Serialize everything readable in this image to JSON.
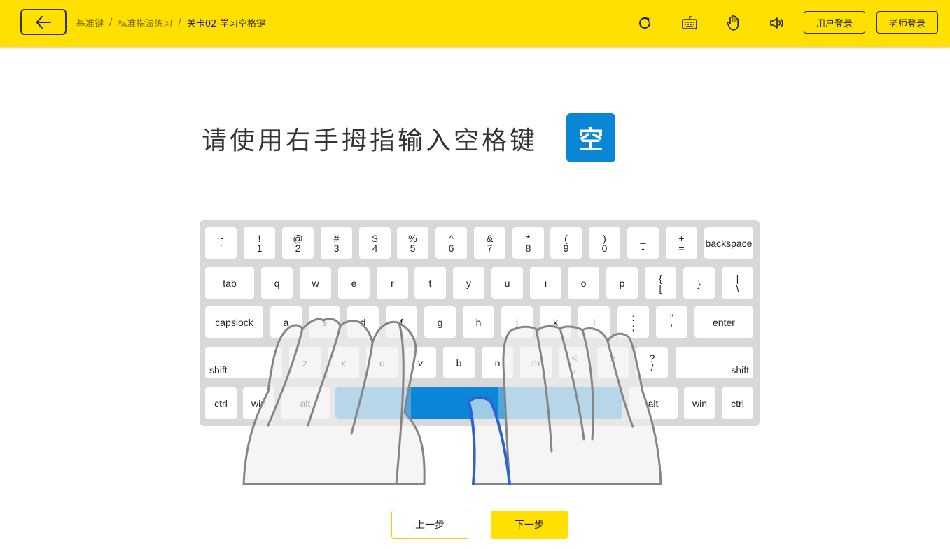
{
  "header": {
    "breadcrumbs": [
      "基准键",
      "标准指法练习",
      "关卡02-学习空格键"
    ],
    "separator": "/",
    "user_login_label": "用户登录",
    "teacher_login_label": "老师登录",
    "icons": [
      "back-arrow-icon",
      "refresh-icon",
      "keyboard-icon",
      "hand-icon",
      "speaker-icon"
    ]
  },
  "main": {
    "instruction": "请使用右手拇指输入空格键",
    "target_key": "空",
    "accent_color": "#0a86d6",
    "brand_color": "#ffe000"
  },
  "keyboard": {
    "rows": [
      [
        {
          "top": "~",
          "bottom": "`"
        },
        {
          "top": "!",
          "bottom": "1"
        },
        {
          "top": "@",
          "bottom": "2"
        },
        {
          "top": "#",
          "bottom": "3"
        },
        {
          "top": "$",
          "bottom": "4"
        },
        {
          "top": "%",
          "bottom": "5"
        },
        {
          "top": "^",
          "bottom": "6"
        },
        {
          "top": "&",
          "bottom": "7"
        },
        {
          "top": "*",
          "bottom": "8"
        },
        {
          "top": "(",
          "bottom": "9"
        },
        {
          "top": ")",
          "bottom": "0"
        },
        {
          "top": "_",
          "bottom": "-"
        },
        {
          "top": "+",
          "bottom": "="
        },
        {
          "top": "",
          "bottom": "backspace"
        }
      ],
      [
        {
          "top": "",
          "bottom": "tab"
        },
        {
          "top": "",
          "bottom": "q"
        },
        {
          "top": "",
          "bottom": "w"
        },
        {
          "top": "",
          "bottom": "e"
        },
        {
          "top": "",
          "bottom": "r"
        },
        {
          "top": "",
          "bottom": "t"
        },
        {
          "top": "",
          "bottom": "y"
        },
        {
          "top": "",
          "bottom": "u"
        },
        {
          "top": "",
          "bottom": "i"
        },
        {
          "top": "",
          "bottom": "o"
        },
        {
          "top": "",
          "bottom": "p"
        },
        {
          "top": "{",
          "bottom": "["
        },
        {
          "top": "",
          "bottom": "}"
        },
        {
          "top": "|",
          "bottom": "\\"
        }
      ],
      [
        {
          "top": "",
          "bottom": "capslock"
        },
        {
          "top": "",
          "bottom": "a"
        },
        {
          "top": "",
          "bottom": "s"
        },
        {
          "top": "",
          "bottom": "d"
        },
        {
          "top": "",
          "bottom": "f"
        },
        {
          "top": "",
          "bottom": "g"
        },
        {
          "top": "",
          "bottom": "h"
        },
        {
          "top": "",
          "bottom": "j"
        },
        {
          "top": "",
          "bottom": "k"
        },
        {
          "top": "",
          "bottom": "l"
        },
        {
          "top": ":",
          "bottom": ";"
        },
        {
          "top": "\"",
          "bottom": "'"
        },
        {
          "top": "",
          "bottom": "enter"
        }
      ],
      [
        {
          "top": "",
          "bottom": "shift"
        },
        {
          "top": "",
          "bottom": "z"
        },
        {
          "top": "",
          "bottom": "x"
        },
        {
          "top": "",
          "bottom": "c"
        },
        {
          "top": "",
          "bottom": "v"
        },
        {
          "top": "",
          "bottom": "b"
        },
        {
          "top": "",
          "bottom": "n"
        },
        {
          "top": "",
          "bottom": "m"
        },
        {
          "top": "<",
          "bottom": ","
        },
        {
          "top": ">",
          "bottom": "."
        },
        {
          "top": "?",
          "bottom": "/"
        },
        {
          "top": "",
          "bottom": "shift"
        }
      ],
      [
        {
          "top": "",
          "bottom": "ctrl"
        },
        {
          "top": "",
          "bottom": "win"
        },
        {
          "top": "",
          "bottom": "alt"
        },
        {
          "top": "",
          "bottom": "alt"
        },
        {
          "top": "",
          "bottom": "win"
        },
        {
          "top": "",
          "bottom": "ctrl"
        }
      ]
    ],
    "highlighted_key": "space"
  },
  "footer": {
    "prev_label": "上一步",
    "next_label": "下一步"
  }
}
